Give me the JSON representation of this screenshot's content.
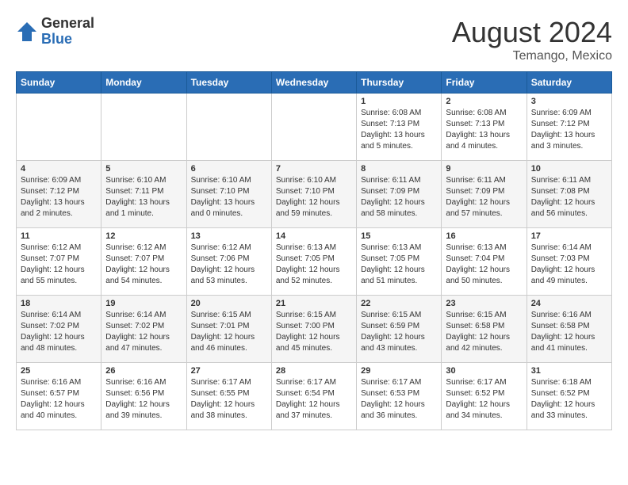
{
  "header": {
    "logo": {
      "general": "General",
      "blue": "Blue"
    },
    "title": "August 2024",
    "location": "Temango, Mexico"
  },
  "days_of_week": [
    "Sunday",
    "Monday",
    "Tuesday",
    "Wednesday",
    "Thursday",
    "Friday",
    "Saturday"
  ],
  "weeks": [
    [
      {
        "day": "",
        "content": ""
      },
      {
        "day": "",
        "content": ""
      },
      {
        "day": "",
        "content": ""
      },
      {
        "day": "",
        "content": ""
      },
      {
        "day": "1",
        "content": "Sunrise: 6:08 AM\nSunset: 7:13 PM\nDaylight: 13 hours\nand 5 minutes."
      },
      {
        "day": "2",
        "content": "Sunrise: 6:08 AM\nSunset: 7:13 PM\nDaylight: 13 hours\nand 4 minutes."
      },
      {
        "day": "3",
        "content": "Sunrise: 6:09 AM\nSunset: 7:12 PM\nDaylight: 13 hours\nand 3 minutes."
      }
    ],
    [
      {
        "day": "4",
        "content": "Sunrise: 6:09 AM\nSunset: 7:12 PM\nDaylight: 13 hours\nand 2 minutes."
      },
      {
        "day": "5",
        "content": "Sunrise: 6:10 AM\nSunset: 7:11 PM\nDaylight: 13 hours\nand 1 minute."
      },
      {
        "day": "6",
        "content": "Sunrise: 6:10 AM\nSunset: 7:10 PM\nDaylight: 13 hours\nand 0 minutes."
      },
      {
        "day": "7",
        "content": "Sunrise: 6:10 AM\nSunset: 7:10 PM\nDaylight: 12 hours\nand 59 minutes."
      },
      {
        "day": "8",
        "content": "Sunrise: 6:11 AM\nSunset: 7:09 PM\nDaylight: 12 hours\nand 58 minutes."
      },
      {
        "day": "9",
        "content": "Sunrise: 6:11 AM\nSunset: 7:09 PM\nDaylight: 12 hours\nand 57 minutes."
      },
      {
        "day": "10",
        "content": "Sunrise: 6:11 AM\nSunset: 7:08 PM\nDaylight: 12 hours\nand 56 minutes."
      }
    ],
    [
      {
        "day": "11",
        "content": "Sunrise: 6:12 AM\nSunset: 7:07 PM\nDaylight: 12 hours\nand 55 minutes."
      },
      {
        "day": "12",
        "content": "Sunrise: 6:12 AM\nSunset: 7:07 PM\nDaylight: 12 hours\nand 54 minutes."
      },
      {
        "day": "13",
        "content": "Sunrise: 6:12 AM\nSunset: 7:06 PM\nDaylight: 12 hours\nand 53 minutes."
      },
      {
        "day": "14",
        "content": "Sunrise: 6:13 AM\nSunset: 7:05 PM\nDaylight: 12 hours\nand 52 minutes."
      },
      {
        "day": "15",
        "content": "Sunrise: 6:13 AM\nSunset: 7:05 PM\nDaylight: 12 hours\nand 51 minutes."
      },
      {
        "day": "16",
        "content": "Sunrise: 6:13 AM\nSunset: 7:04 PM\nDaylight: 12 hours\nand 50 minutes."
      },
      {
        "day": "17",
        "content": "Sunrise: 6:14 AM\nSunset: 7:03 PM\nDaylight: 12 hours\nand 49 minutes."
      }
    ],
    [
      {
        "day": "18",
        "content": "Sunrise: 6:14 AM\nSunset: 7:02 PM\nDaylight: 12 hours\nand 48 minutes."
      },
      {
        "day": "19",
        "content": "Sunrise: 6:14 AM\nSunset: 7:02 PM\nDaylight: 12 hours\nand 47 minutes."
      },
      {
        "day": "20",
        "content": "Sunrise: 6:15 AM\nSunset: 7:01 PM\nDaylight: 12 hours\nand 46 minutes."
      },
      {
        "day": "21",
        "content": "Sunrise: 6:15 AM\nSunset: 7:00 PM\nDaylight: 12 hours\nand 45 minutes."
      },
      {
        "day": "22",
        "content": "Sunrise: 6:15 AM\nSunset: 6:59 PM\nDaylight: 12 hours\nand 43 minutes."
      },
      {
        "day": "23",
        "content": "Sunrise: 6:15 AM\nSunset: 6:58 PM\nDaylight: 12 hours\nand 42 minutes."
      },
      {
        "day": "24",
        "content": "Sunrise: 6:16 AM\nSunset: 6:58 PM\nDaylight: 12 hours\nand 41 minutes."
      }
    ],
    [
      {
        "day": "25",
        "content": "Sunrise: 6:16 AM\nSunset: 6:57 PM\nDaylight: 12 hours\nand 40 minutes."
      },
      {
        "day": "26",
        "content": "Sunrise: 6:16 AM\nSunset: 6:56 PM\nDaylight: 12 hours\nand 39 minutes."
      },
      {
        "day": "27",
        "content": "Sunrise: 6:17 AM\nSunset: 6:55 PM\nDaylight: 12 hours\nand 38 minutes."
      },
      {
        "day": "28",
        "content": "Sunrise: 6:17 AM\nSunset: 6:54 PM\nDaylight: 12 hours\nand 37 minutes."
      },
      {
        "day": "29",
        "content": "Sunrise: 6:17 AM\nSunset: 6:53 PM\nDaylight: 12 hours\nand 36 minutes."
      },
      {
        "day": "30",
        "content": "Sunrise: 6:17 AM\nSunset: 6:52 PM\nDaylight: 12 hours\nand 34 minutes."
      },
      {
        "day": "31",
        "content": "Sunrise: 6:18 AM\nSunset: 6:52 PM\nDaylight: 12 hours\nand 33 minutes."
      }
    ]
  ]
}
